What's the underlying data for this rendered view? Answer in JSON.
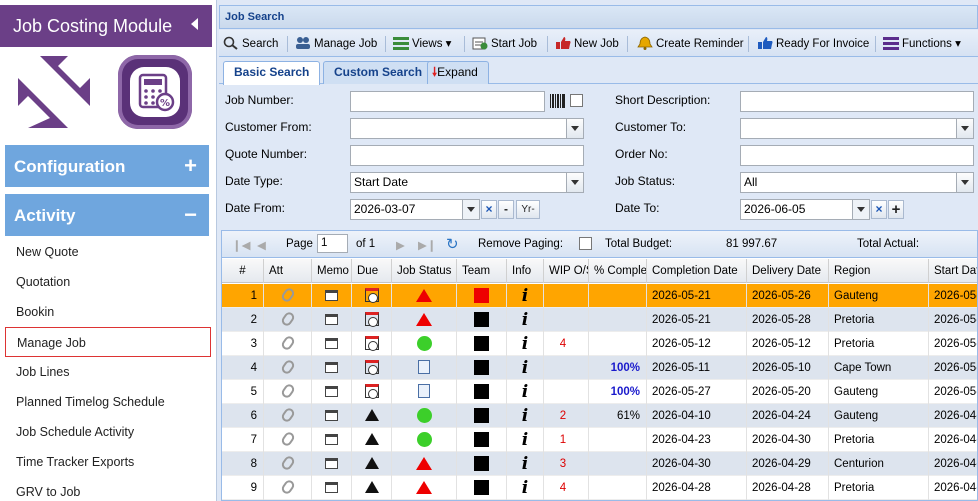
{
  "sidebar": {
    "title": "Job Costing Module",
    "sections": [
      {
        "label": "Configuration",
        "sign": "+"
      },
      {
        "label": "Activity",
        "sign": "−"
      }
    ],
    "items": [
      {
        "label": "New Quote"
      },
      {
        "label": "Quotation"
      },
      {
        "label": "Bookin"
      },
      {
        "label": "Manage Job",
        "active": true
      },
      {
        "label": "Job Lines"
      },
      {
        "label": "Planned Timelog Schedule"
      },
      {
        "label": "Job Schedule Activity"
      },
      {
        "label": "Time Tracker Exports"
      },
      {
        "label": "GRV to Job"
      }
    ]
  },
  "panel": {
    "title": "Job Search"
  },
  "toolbar": {
    "search": "Search",
    "manage_job": "Manage Job",
    "views": "Views",
    "start_job": "Start Job",
    "new_job": "New Job",
    "create_reminder": "Create Reminder",
    "ready_for_invoice": "Ready For Invoice",
    "functions": "Functions"
  },
  "tabs": {
    "basic": "Basic Search",
    "custom": "Custom Search",
    "expand": "Expand"
  },
  "form": {
    "job_number_label": "Job Number:",
    "customer_from_label": "Customer From:",
    "quote_number_label": "Quote Number:",
    "date_type_label": "Date Type:",
    "date_type_value": "Start Date",
    "date_from_label": "Date From:",
    "date_from_value": "2026-03-07",
    "short_desc_label": "Short Description:",
    "customer_to_label": "Customer To:",
    "order_no_label": "Order No:",
    "job_status_label": "Job Status:",
    "job_status_value": "All",
    "date_to_label": "Date To:",
    "date_to_value": "2026-06-05",
    "yr_label": "Yr-",
    "minus_label": "-",
    "plus_label": "+",
    "clear_label": "×"
  },
  "pager": {
    "page_label": "Page",
    "page_value": "1",
    "of_label": "of 1",
    "remove_paging": "Remove Paging:",
    "total_budget_label": "Total Budget:",
    "total_budget_value": "81 997.67",
    "total_actual_label": "Total Actual:"
  },
  "columns": [
    "#",
    "Att",
    "Memo",
    "Due",
    "Job Status",
    "Team",
    "Info",
    "WIP O/S",
    "% Complete",
    "Completion Date",
    "Delivery Date",
    "Region",
    "Start Date"
  ],
  "rows": [
    {
      "n": "1",
      "status": "tri",
      "due": "cal",
      "team": "#ee0000",
      "wip": "",
      "pct": "",
      "completion": "2026-05-21",
      "delivery": "2026-05-26",
      "region": "Gauteng",
      "start": "2026-05-",
      "style": "sel"
    },
    {
      "n": "2",
      "status": "tri",
      "due": "cal",
      "team": "#000000",
      "wip": "",
      "pct": "",
      "completion": "2026-05-21",
      "delivery": "2026-05-28",
      "region": "Pretoria",
      "start": "2026-05-",
      "style": "alt"
    },
    {
      "n": "3",
      "status": "circ",
      "due": "cal",
      "team": "#000000",
      "wip": "4",
      "pct": "",
      "completion": "2026-05-12",
      "delivery": "2026-05-12",
      "region": "Pretoria",
      "start": "2026-05-",
      "style": ""
    },
    {
      "n": "4",
      "status": "doc",
      "due": "cal",
      "team": "#000000",
      "wip": "",
      "pct": "100%",
      "completion": "2026-05-11",
      "delivery": "2026-05-10",
      "region": "Cape Town",
      "start": "2026-05-",
      "style": "alt"
    },
    {
      "n": "5",
      "status": "doc",
      "due": "cal",
      "team": "#000000",
      "wip": "",
      "pct": "100%",
      "completion": "2026-05-27",
      "delivery": "2026-05-20",
      "region": "Gauteng",
      "start": "2026-05-",
      "style": ""
    },
    {
      "n": "6",
      "status": "circ",
      "due": "warn",
      "team": "#000000",
      "wip": "2",
      "pct": "61%",
      "completion": "2026-04-10",
      "delivery": "2026-04-24",
      "region": "Gauteng",
      "start": "2026-04-",
      "style": "alt"
    },
    {
      "n": "7",
      "status": "circ",
      "due": "warn",
      "team": "#000000",
      "wip": "1",
      "pct": "",
      "completion": "2026-04-23",
      "delivery": "2026-04-30",
      "region": "Pretoria",
      "start": "2026-04-",
      "style": ""
    },
    {
      "n": "8",
      "status": "tri",
      "due": "warn",
      "team": "#000000",
      "wip": "3",
      "pct": "",
      "completion": "2026-04-30",
      "delivery": "2026-04-29",
      "region": "Centurion",
      "start": "2026-04-",
      "style": "alt"
    },
    {
      "n": "9",
      "status": "tri",
      "due": "warn",
      "team": "#000000",
      "wip": "4",
      "pct": "",
      "completion": "2026-04-28",
      "delivery": "2026-04-28",
      "region": "Pretoria",
      "start": "2026-04-",
      "style": ""
    }
  ],
  "colors": {
    "brand": "#6b3f87",
    "section": "#6fa6de",
    "selected_row": "#ffa500"
  }
}
